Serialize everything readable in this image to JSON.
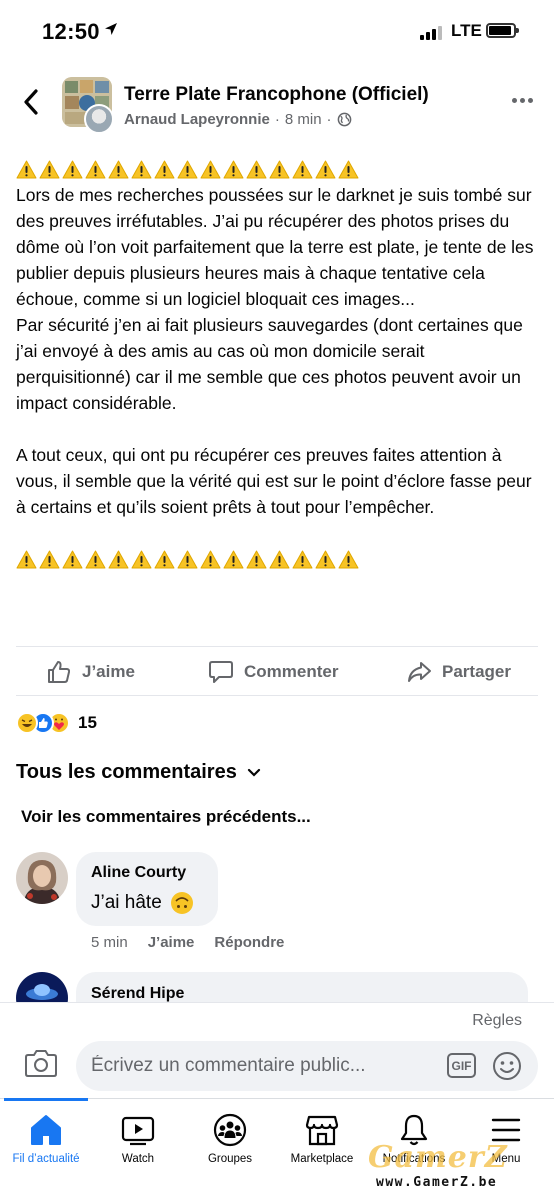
{
  "status_bar": {
    "time": "12:50",
    "network": "LTE"
  },
  "post": {
    "group_name": "Terre Plate Francophone (Officiel)",
    "author": "Arnaud Lapeyronnie",
    "time": "8 min",
    "separator": "·",
    "warning_count": 15,
    "paragraph_1": "Lors de mes recherches poussées sur le darknet je suis tombé sur des preuves irréfutables. J’ai pu récupérer des photos prises du dôme où l’on voit parfaitement que la terre est plate, je tente de les publier depuis plusieurs heures mais à chaque tentative cela échoue, comme si un logiciel bloquait ces images...",
    "paragraph_2": "Par sécurité j’en ai fait plusieurs sauvegardes (dont certaines que j’ai envoyé à des amis au cas où mon domicile serait perquisitionné) car il me semble que ces photos peuvent avoir un impact considérable.",
    "paragraph_3": "A tout ceux, qui ont pu récupérer ces preuves faites attention à vous, il semble que la vérité qui est sur le point d’éclore fasse peur à certains et qu’ils soient prêts à tout pour l’empêcher."
  },
  "actions": {
    "like": "J’aime",
    "comment": "Commenter",
    "share": "Partager"
  },
  "reactions": {
    "count": "15",
    "types": [
      "haha",
      "like",
      "care"
    ]
  },
  "comments_section": {
    "title": "Tous les commentaires",
    "previous": "Voir les commentaires précédents..."
  },
  "comments": [
    {
      "name": "Aline Courty",
      "text": "J’ai hâte",
      "emoji": "upside-down-face",
      "time": "5 min",
      "like": "J’aime",
      "reply": "Répondre"
    },
    {
      "name": "Sérend Hipe"
    }
  ],
  "composer": {
    "rules": "Règles",
    "placeholder": "Écrivez un commentaire public...",
    "gif": "GIF"
  },
  "tabs": [
    {
      "label": "Fil d’actualité",
      "icon": "home-icon",
      "active": true
    },
    {
      "label": "Watch",
      "icon": "video-icon"
    },
    {
      "label": "Groupes",
      "icon": "groups-icon"
    },
    {
      "label": "Marketplace",
      "icon": "marketplace-icon"
    },
    {
      "label": "Notifications",
      "icon": "bell-icon"
    },
    {
      "label": "Menu",
      "icon": "menu-icon"
    }
  ],
  "watermark": {
    "logo": "GamerZ",
    "url": "www.GamerZ.be"
  },
  "colors": {
    "accent": "#1877f2",
    "secondary_text": "#65676b",
    "bubble": "#f0f2f5",
    "warning": "#f7c325"
  }
}
